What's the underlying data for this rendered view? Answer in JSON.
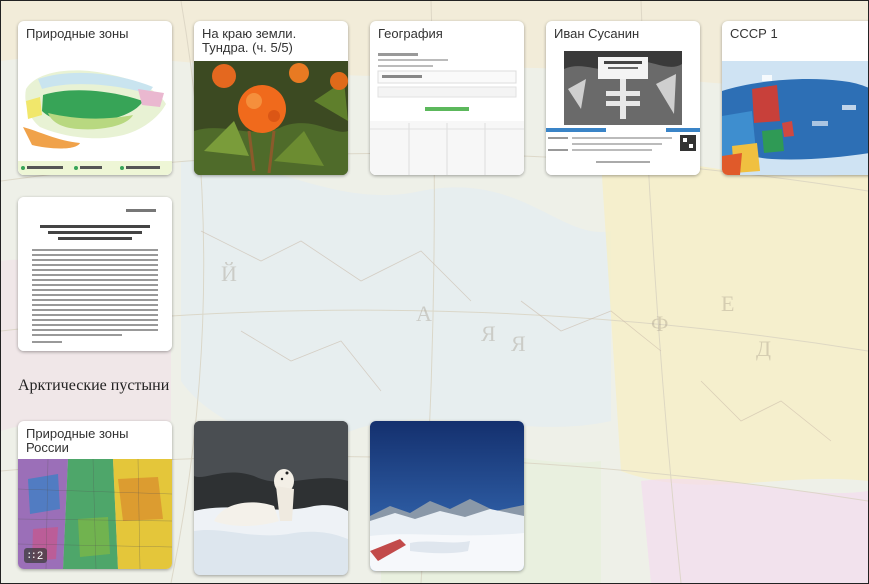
{
  "cards_row1": [
    {
      "title": "Природные зоны"
    },
    {
      "title": "На краю земли. Тундра. (ч. 5/5)"
    },
    {
      "title": "География"
    },
    {
      "title": "Иван Сусанин"
    },
    {
      "title": "СССР 1"
    }
  ],
  "section": {
    "heading": "Арктические пустыни"
  },
  "cards_row3": [
    {
      "title": "Природные зоны России",
      "badge_count": "2"
    },
    {
      "title": ""
    },
    {
      "title": ""
    }
  ],
  "colors": {
    "accent_green": "#2e8b3a",
    "accent_blue": "#2e6fb4"
  }
}
